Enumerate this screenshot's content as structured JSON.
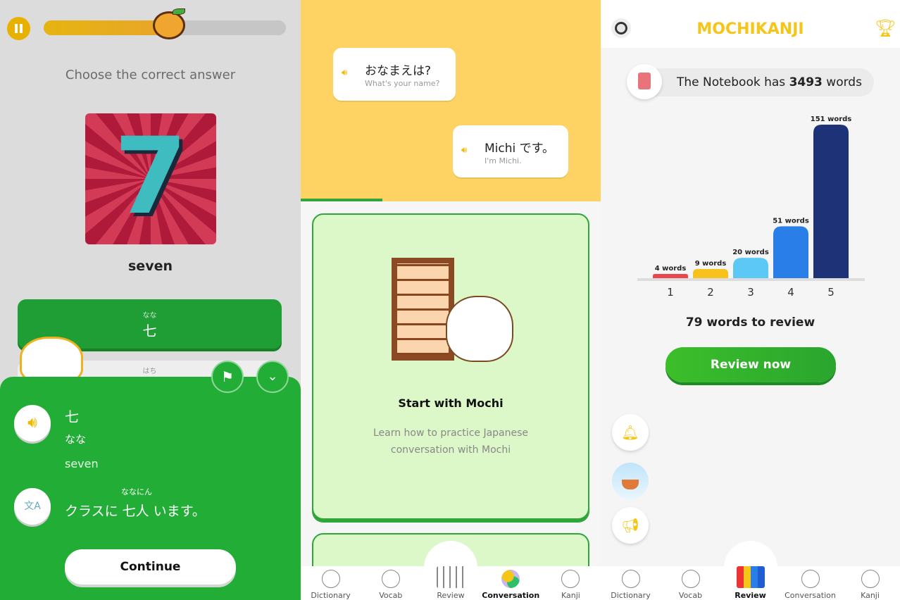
{
  "quiz": {
    "progress_percent": 52,
    "instruction": "Choose the correct answer",
    "prompt_word": "seven",
    "options": [
      {
        "furigana": "なな",
        "kanji": "七",
        "state": "correct"
      },
      {
        "furigana": "はち",
        "kanji": ""
      }
    ],
    "result_sheet": {
      "kanji": "七",
      "reading": "なな",
      "meaning": "seven",
      "example_furigana": "ななにん",
      "example_before": "クラスに",
      "example_kanji": "七人",
      "example_after": "います。",
      "continue_label": "Continue"
    },
    "colors": {
      "accent_green": "#22ae36",
      "progress": "#e8b100"
    }
  },
  "conversation": {
    "bubbles": [
      {
        "jp": "おなまえは?",
        "en": "What's your name?"
      },
      {
        "jp": "Michi です。",
        "en": "I'm Michi."
      }
    ],
    "card": {
      "title": "Start with Mochi",
      "description_line1": "Learn how to practice Japanese",
      "description_line2": "conversation with Mochi"
    },
    "nav": [
      {
        "label": "Dictionary",
        "icon": "magnifier-icon"
      },
      {
        "label": "Vocab",
        "icon": "graduation-cap-icon"
      },
      {
        "label": "Review",
        "icon": "bar-chart-icon"
      },
      {
        "label": "Conversation",
        "icon": "chat-icon",
        "active": true
      },
      {
        "label": "Kanji",
        "icon": "notebook-pen-icon"
      }
    ]
  },
  "review": {
    "logo": "MOCHIKANJI",
    "notebook_prefix": "The Notebook has",
    "notebook_count": "3493",
    "notebook_suffix": "words",
    "to_review": "79 words to review",
    "review_button": "Review now",
    "nav": [
      {
        "label": "Dictionary",
        "icon": "magnifier-icon"
      },
      {
        "label": "Vocab",
        "icon": "graduation-cap-icon"
      },
      {
        "label": "Review",
        "icon": "bar-chart-icon",
        "active": true
      },
      {
        "label": "Conversation",
        "icon": "chat-icon"
      },
      {
        "label": "Kanji",
        "icon": "notebook-pen-icon"
      }
    ]
  },
  "chart_data": {
    "type": "bar",
    "categories": [
      "1",
      "2",
      "3",
      "4",
      "5"
    ],
    "values": [
      4,
      9,
      20,
      51,
      151
    ],
    "data_labels": [
      "4 words",
      "9 words",
      "20 words",
      "51 words",
      "151 words"
    ],
    "colors": [
      "#e8474e",
      "#f7c21b",
      "#5bc8f5",
      "#2a7ee8",
      "#1e3278"
    ],
    "grid": false
  }
}
